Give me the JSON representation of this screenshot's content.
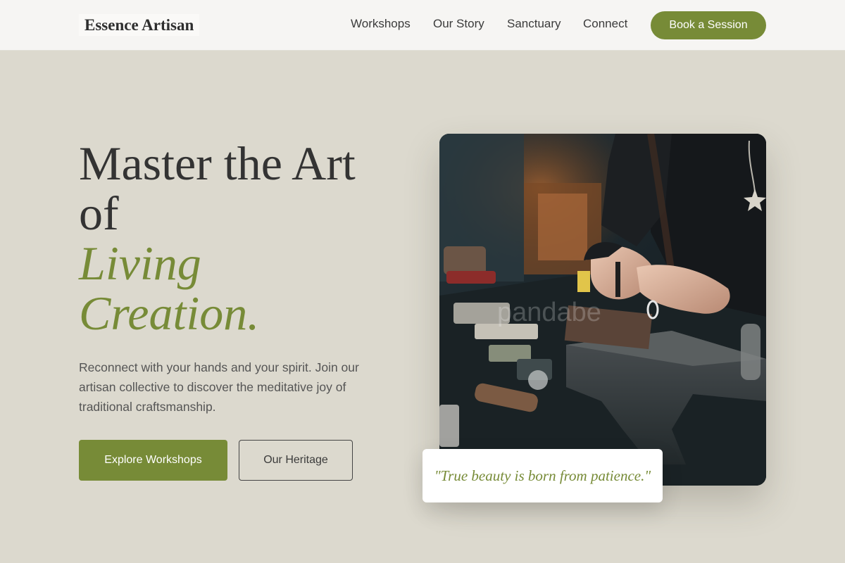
{
  "header": {
    "brand": "Essence Artisan",
    "nav": [
      {
        "label": "Workshops"
      },
      {
        "label": "Our Story"
      },
      {
        "label": "Sanctuary"
      },
      {
        "label": "Connect"
      }
    ],
    "cta_label": "Book a Session"
  },
  "hero": {
    "headline_lines": [
      "Master the Art",
      "of"
    ],
    "headline_accent_lines": [
      "Living",
      "Creation."
    ],
    "lead": "Reconnect with your hands and your spirit. Join our artisan collective to discover the meditative joy of traditional craftsmanship.",
    "primary_button": "Explore Workshops",
    "secondary_button": "Our Heritage",
    "image_watermark": "pandabe",
    "quote": "\"True beauty is born from patience.\""
  },
  "colors": {
    "accent": "#778b37",
    "page_background": "#dcd9ce",
    "header_background": "#f6f5f3",
    "text_dark": "#333333"
  },
  "icons": {
    "hero_image": "artisan-jewelry-workbench-photo"
  }
}
